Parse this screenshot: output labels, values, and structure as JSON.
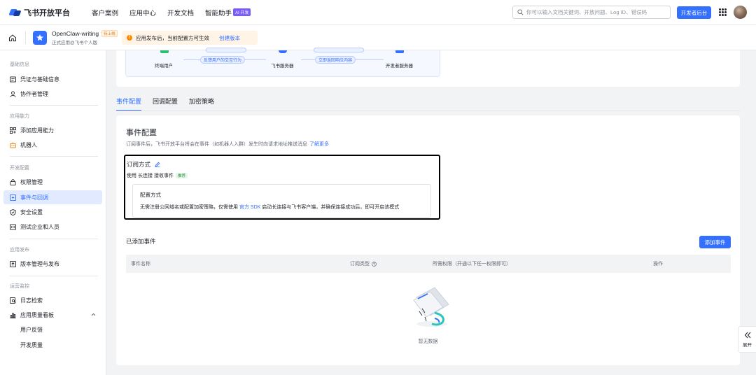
{
  "nav": {
    "logo_text": "飞书开放平台",
    "links": [
      "客户案例",
      "应用中心",
      "开发文档",
      "智能助手"
    ],
    "ai_badge": "AI 开发",
    "search_placeholder": "你可以输入文档关键词、开放问题、Log ID、错误码",
    "console_button": "开发者后台"
  },
  "appbar": {
    "app_name": "OpenClaw-writing",
    "app_badge": "待上线",
    "app_sub": "正式应用@飞书个人版",
    "notice_text": "应用发布后，当前配置方可生效",
    "notice_link": "创建版本"
  },
  "sidebar": {
    "groups": {
      "basic": "基础信息",
      "ability": "应用能力",
      "dev": "开发配置",
      "release": "应用发布",
      "ops": "运营监控"
    },
    "items": {
      "credentials": "凭证与基础信息",
      "collaborators": "协作者管理",
      "add_ability": "添加应用能力",
      "bot": "机器人",
      "permissions": "权限管理",
      "events": "事件与回调",
      "security": "安全设置",
      "test_org": "测试企业和人员",
      "versions": "版本管理与发布",
      "logs": "日志检索",
      "quality": "应用质量看板",
      "feedback": "用户反馈",
      "dev_quality": "开发质量"
    }
  },
  "flow": {
    "end_user": "终端用户",
    "feedback": "反馈用户的交互行为",
    "feishu_server": "飞书服务器",
    "return": "立即返回响应内容",
    "dev_server": "开发者服务器"
  },
  "tabs": [
    "事件配置",
    "回调配置",
    "加密策略"
  ],
  "event_config": {
    "title": "事件配置",
    "desc": "订阅事件后，飞书开放平台将会在事件（如机器人入群）发生时向请求地址推送消息",
    "learn_more": "了解更多",
    "sub_method_title": "订阅方式",
    "sub_line_prefix": "使用",
    "sub_line_mode": "长连接",
    "sub_line_suffix": "接收事件",
    "recommended": "推荐",
    "config_title": "配置方式",
    "config_text_pre": "无需注册公网域名或配置加密策略，仅需使用",
    "config_link": "官方 SDK",
    "config_text_post": "启动长连接与飞书客户端，并确保连接成功后，即可开启该模式"
  },
  "added_events": {
    "title": "已添加事件",
    "add_button": "添加事件",
    "columns": [
      "事件名称",
      "订阅类型",
      "所需权限（开通以下任一权限即可）",
      "操作"
    ],
    "empty": "暂无数据"
  },
  "expand_label": "展开",
  "colors": {
    "accent": "#3370ff",
    "warning": "#ff8800"
  }
}
